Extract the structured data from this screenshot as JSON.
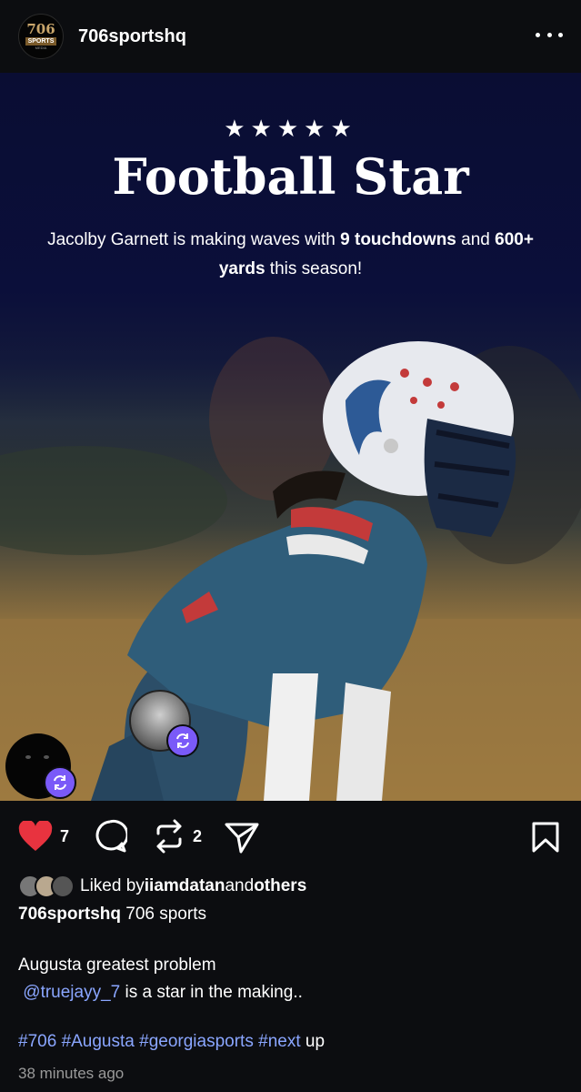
{
  "header": {
    "avatar": {
      "num": "706",
      "brand": "SPORTS",
      "sub": "MEDIA"
    },
    "username": "706sportshq"
  },
  "post": {
    "stars": "★★★★★",
    "title": "Football Star",
    "subtitle": {
      "pre": "Jacolby Garnett is making waves with ",
      "bold1": "9 touchdowns",
      "mid": " and ",
      "bold2": "600+ yards",
      "post": " this season!"
    }
  },
  "actions": {
    "like_count": "7",
    "repost_count": "2"
  },
  "likes": {
    "prefix": "Liked by ",
    "user": "iiamdatan",
    "mid": " and ",
    "others": "others"
  },
  "caption": {
    "author": "706sportshq",
    "author_text": " 706 sports",
    "line1": "Augusta greatest problem",
    "mention": "@truejayy_7",
    "line2_rest": " is a star in the making..",
    "tags": [
      "#706",
      "#Augusta",
      "#georgiasports",
      "#next"
    ],
    "tags_tail": " up",
    "time": "38 minutes ago"
  },
  "colors": {
    "like": "#e8333f",
    "badge": "#7a5af8",
    "link": "#8aa6ff"
  }
}
